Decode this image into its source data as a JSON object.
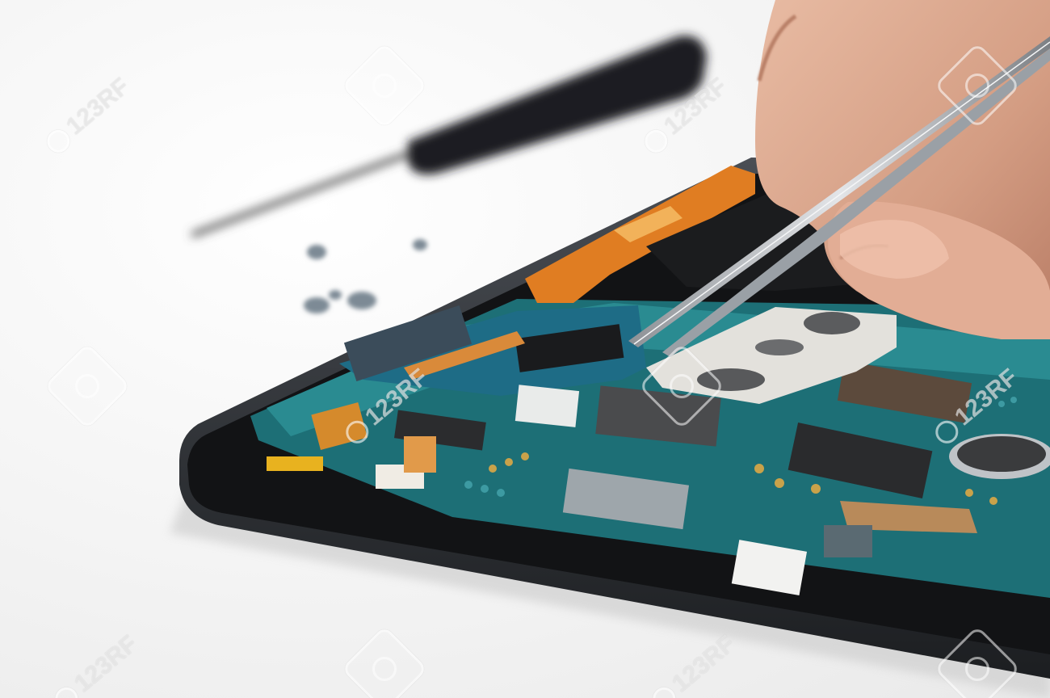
{
  "scene": {
    "subject": "smartphone-repair",
    "watermark_text": "123RF",
    "colors": {
      "background": "#f4f4f4",
      "phone_frame": "#2a2d31",
      "pcb_green": "#1f7f86",
      "flex_cable_orange": "#e0822a",
      "skin": "#d9a68c",
      "metal": "#b9bcc0"
    }
  }
}
